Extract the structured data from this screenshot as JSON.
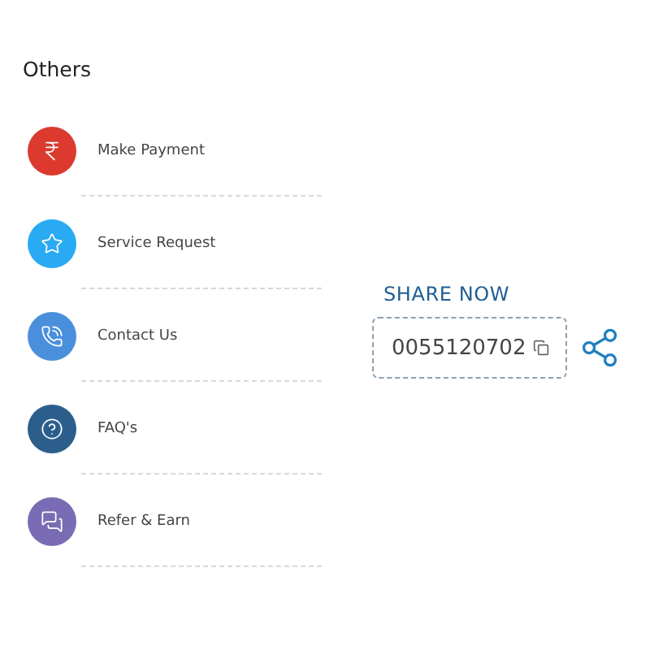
{
  "section_title": "Others",
  "items": [
    {
      "label": "Make Payment",
      "color": "#dc3a2e"
    },
    {
      "label": "Service Request",
      "color": "#2aaaf2"
    },
    {
      "label": "Contact Us",
      "color": "#4a8fdc"
    },
    {
      "label": "FAQ's",
      "color": "#2c5e8c"
    },
    {
      "label": "Refer & Earn",
      "color": "#7a6cb4"
    }
  ],
  "share": {
    "title": "SHARE NOW",
    "code": "0055120702"
  }
}
